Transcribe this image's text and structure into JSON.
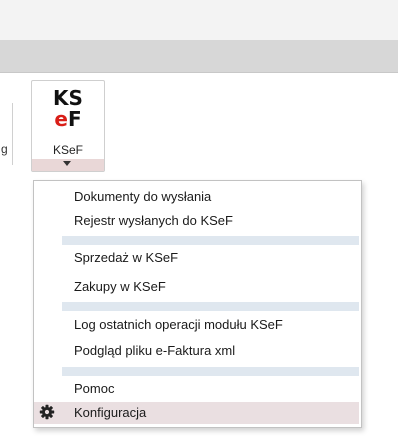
{
  "ribbon": {
    "left_stub_glyph": "g",
    "kse_button": {
      "logo_line1": "KS",
      "logo_line2_accent": "e",
      "logo_line2_rest": "F",
      "label": "KSeF"
    }
  },
  "menu": {
    "items": [
      {
        "label": "Dokumenty do wysłania"
      },
      {
        "label": "Rejestr wysłanych do KSeF"
      },
      {
        "label": "Sprzedaż w KSeF"
      },
      {
        "label": "Zakupy w KSeF"
      },
      {
        "label": "Log ostatnich operacji modułu KSeF"
      },
      {
        "label": "Podgląd pliku e-Faktura xml"
      },
      {
        "label": "Pomoc"
      },
      {
        "label": "Konfiguracja",
        "icon": "gear-icon"
      }
    ]
  },
  "colors": {
    "hover_bg": "#eadfe1",
    "separator_bg": "#dfe7ef",
    "logo_accent": "#d91e18"
  }
}
